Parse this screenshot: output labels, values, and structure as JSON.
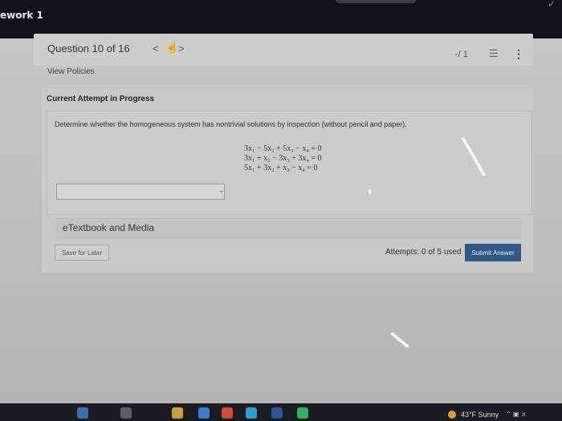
{
  "window": {
    "title": "ework 1"
  },
  "header": {
    "question_label": "Question 10 of 16",
    "prev": "<",
    "next": ">",
    "score": "-/ 1",
    "view_policies": "View Policies"
  },
  "attempt": {
    "heading": "Current Attempt in Progress"
  },
  "question": {
    "prompt": "Determine whether the homogeneous system has nontrivial solutions by inspection (without pencil and paper).",
    "equations": [
      "3x₁ − 5x₂ + 5x₃ − x₄ = 0",
      "3x₁ + x₂ − 3x₃ + 3x₄ = 0",
      "5x₁ + 3x₂ + x₃ − x₄ = 0"
    ],
    "answer_value": ""
  },
  "etextbook": {
    "label": "eTextbook and Media"
  },
  "actions": {
    "save_label": "Save for Later",
    "attempts_text": "Attempts: 0 of 5 used",
    "submit_label": "Submit Answer"
  },
  "taskbar": {
    "weather": "43°F  Sunny"
  },
  "colors": {
    "submit": "#2d5a86",
    "topbar": "#101217"
  }
}
